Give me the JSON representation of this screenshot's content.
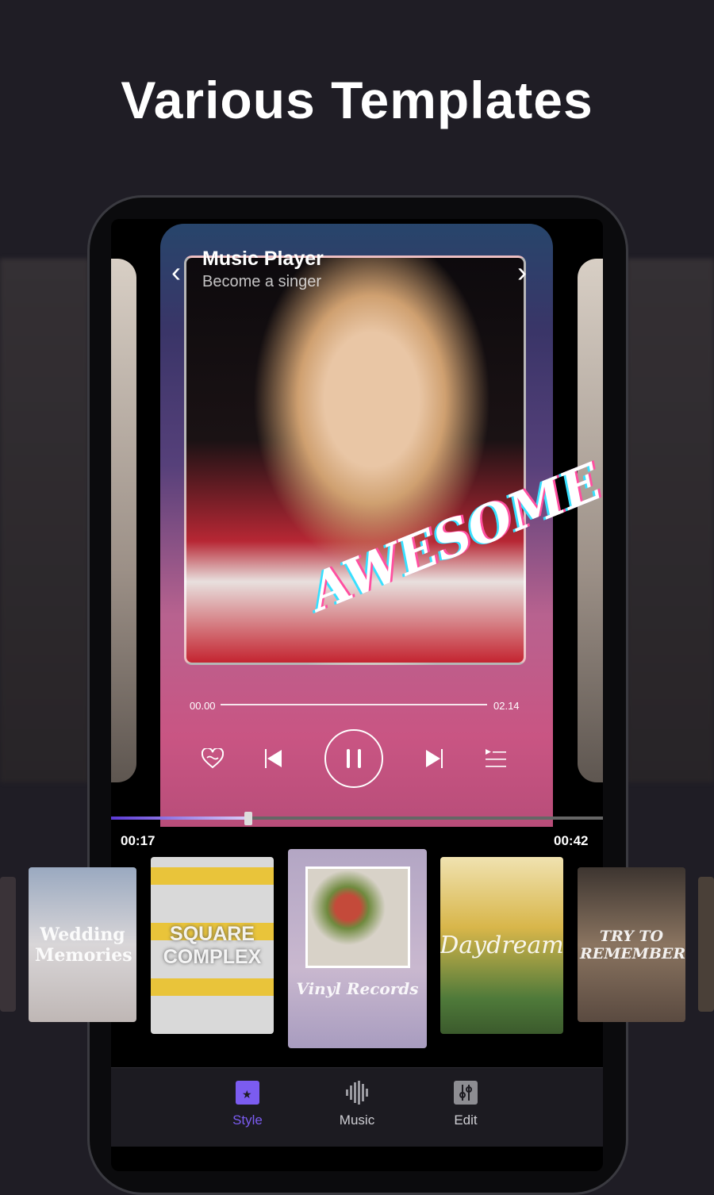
{
  "headline": "Various Templates",
  "player": {
    "title": "Music Player",
    "subtitle": "Become a singer",
    "overlay_text": "AWESOME",
    "time_start": "00.00",
    "time_end": "02.14",
    "controls": [
      "heart-icon",
      "previous-icon",
      "pause-icon",
      "next-icon",
      "playlist-icon"
    ]
  },
  "timeline": {
    "current": "00:17",
    "total": "00:42",
    "progress_percent": 27.9
  },
  "templates": [
    {
      "label": "Wedding Memories"
    },
    {
      "label": "SQUARE COMPLEX"
    },
    {
      "label": "Vinyl Records",
      "selected": true
    },
    {
      "label": "Daydream"
    },
    {
      "label": "TRY TO REMEMBER"
    }
  ],
  "nav": [
    {
      "label": "Style",
      "active": true
    },
    {
      "label": "Music"
    },
    {
      "label": "Edit"
    }
  ],
  "colors": {
    "accent": "#7b5cf0",
    "background": "#1f1d25",
    "nav_inactive": "#cfcfd4"
  }
}
